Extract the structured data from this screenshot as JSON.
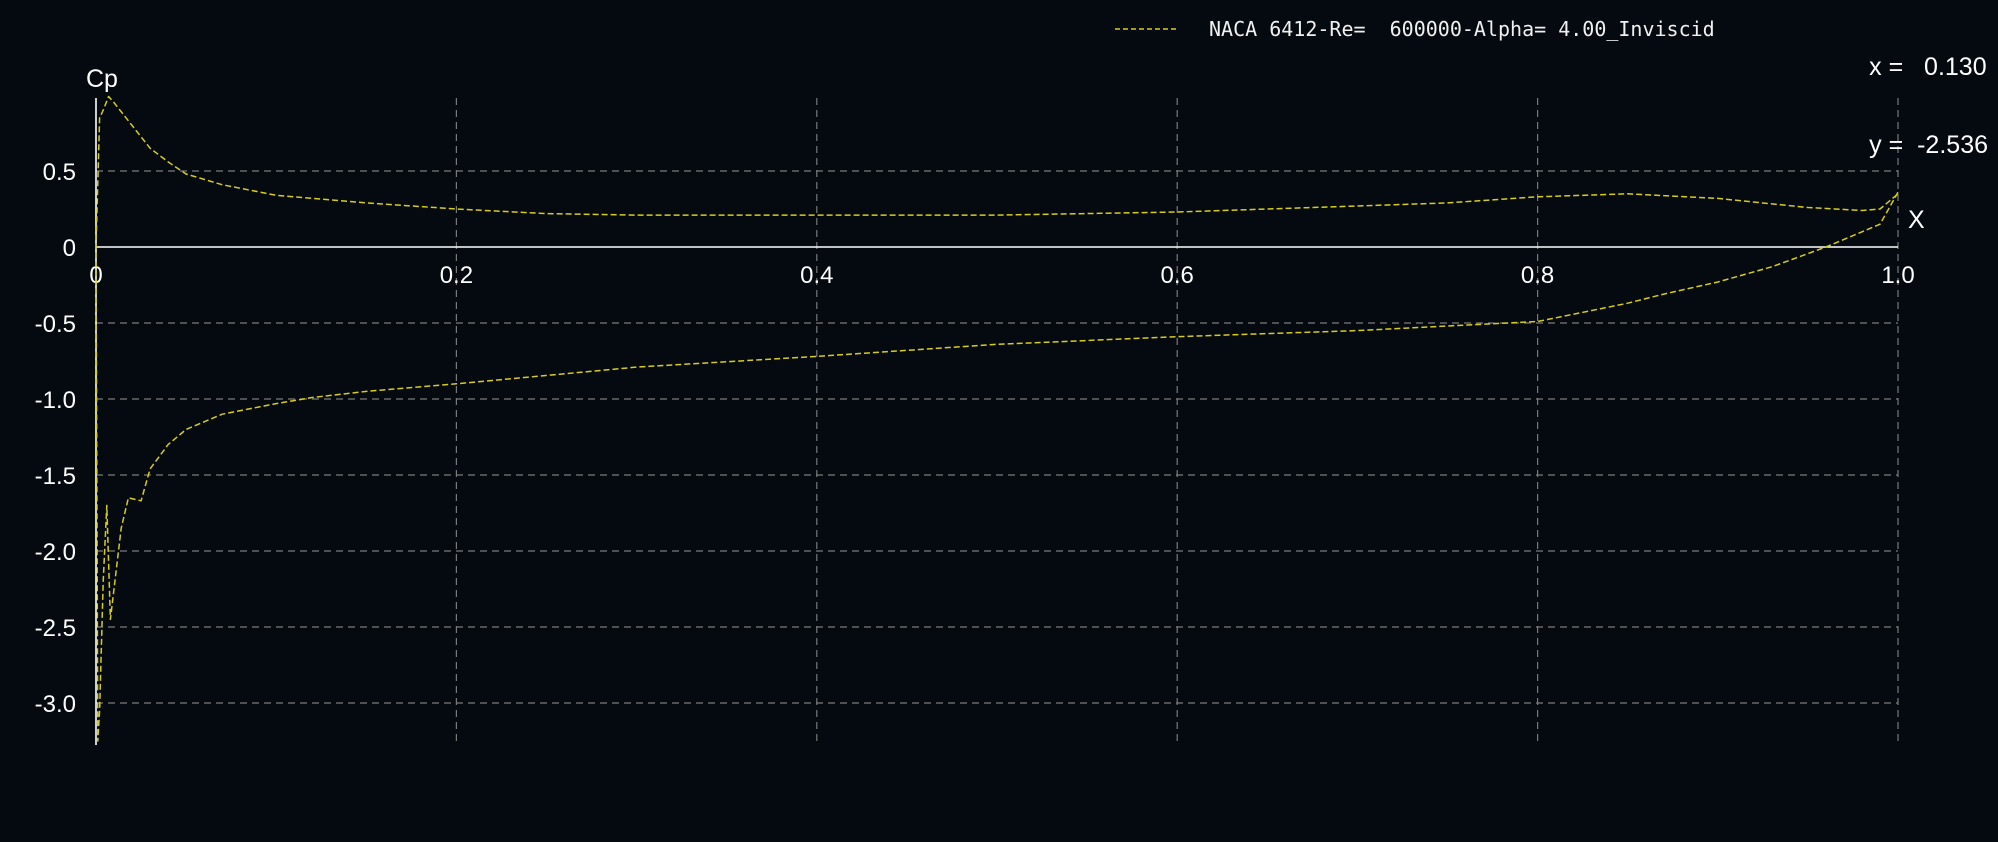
{
  "chart_data": {
    "type": "line",
    "xlabel": "X",
    "ylabel": "Cp",
    "xlim": [
      0,
      1
    ],
    "ylim": [
      -3.25,
      0.98
    ],
    "y_inverted": false,
    "grid": true,
    "grid_style": "dashed",
    "legend_placement": "top-right",
    "xticks": [
      {
        "v": 0,
        "label": "0"
      },
      {
        "v": 0.2,
        "label": "0.2"
      },
      {
        "v": 0.4,
        "label": "0.4"
      },
      {
        "v": 0.6,
        "label": "0.6"
      },
      {
        "v": 0.8,
        "label": "0.8"
      },
      {
        "v": 1.0,
        "label": "1.0"
      }
    ],
    "yticks": [
      {
        "v": 0.5,
        "label": "0.5"
      },
      {
        "v": 0,
        "label": "0"
      },
      {
        "v": -0.5,
        "label": "-0.5"
      },
      {
        "v": -1.0,
        "label": "-1.0"
      },
      {
        "v": -1.5,
        "label": "-1.5"
      },
      {
        "v": -2.0,
        "label": "-2.0"
      },
      {
        "v": -2.5,
        "label": "-2.5"
      },
      {
        "v": -3.0,
        "label": "-3.0"
      }
    ],
    "series": [
      {
        "name": "NACA 6412-Re=  600000-Alpha= 4.00_Inviscid",
        "color": "#d8cc1a",
        "x": [
          1.0,
          0.99,
          0.98,
          0.96,
          0.93,
          0.9,
          0.87,
          0.85,
          0.8,
          0.75,
          0.7,
          0.65,
          0.6,
          0.5,
          0.4,
          0.3,
          0.2,
          0.15,
          0.12,
          0.1,
          0.07,
          0.05,
          0.04,
          0.03,
          0.025,
          0.018,
          0.014,
          0.011,
          0.008,
          0.006,
          0.004,
          0.002,
          0.001,
          0.0,
          0.002,
          0.004,
          0.007,
          0.01,
          0.02,
          0.03,
          0.04,
          0.05,
          0.07,
          0.1,
          0.15,
          0.2,
          0.25,
          0.3,
          0.4,
          0.5,
          0.6,
          0.7,
          0.75,
          0.8,
          0.85,
          0.9,
          0.95,
          0.98,
          0.99,
          1.0
        ],
        "y": [
          0.36,
          0.15,
          0.1,
          0.0,
          -0.13,
          -0.23,
          -0.31,
          -0.37,
          -0.49,
          -0.52,
          -0.55,
          -0.57,
          -0.59,
          -0.64,
          -0.72,
          -0.79,
          -0.9,
          -0.95,
          -0.99,
          -1.03,
          -1.1,
          -1.2,
          -1.3,
          -1.46,
          -1.67,
          -1.65,
          -1.85,
          -2.15,
          -2.45,
          -1.7,
          -2.2,
          -3.05,
          -3.25,
          0.0,
          0.85,
          0.9,
          0.99,
          0.95,
          0.8,
          0.65,
          0.56,
          0.48,
          0.41,
          0.34,
          0.29,
          0.25,
          0.22,
          0.21,
          0.21,
          0.21,
          0.23,
          0.27,
          0.29,
          0.33,
          0.35,
          0.32,
          0.26,
          0.24,
          0.25,
          0.35
        ]
      }
    ]
  },
  "legend": {
    "label": "NACA 6412-Re=  600000-Alpha= 4.00_Inviscid"
  },
  "readout": {
    "x_text": "x =   0.130",
    "y_text": "y =  -2.536"
  },
  "colors": {
    "background": "#040a10",
    "axis": "#ffffff",
    "grid": "#7a7a7a",
    "curve": "#d8cc1a"
  }
}
